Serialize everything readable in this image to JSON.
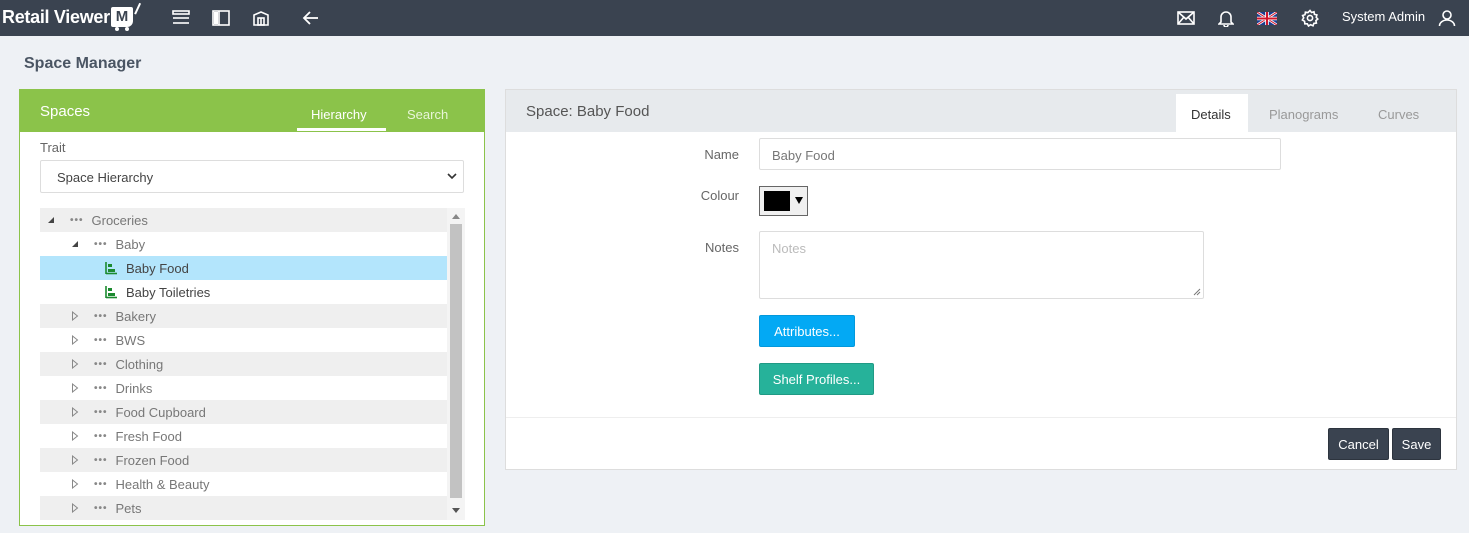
{
  "app": {
    "brand": "Retail Viewer",
    "brand_mark": "M",
    "user_name": "System Admin"
  },
  "page": {
    "title": "Space Manager"
  },
  "spaces_panel": {
    "title": "Spaces",
    "tabs": [
      {
        "label": "Hierarchy",
        "active": true
      },
      {
        "label": "Search",
        "active": false
      }
    ],
    "trait_label": "Trait",
    "trait_value": "Space Hierarchy",
    "tree": [
      {
        "label": "Groceries",
        "level": 0,
        "state": "expanded",
        "type": "group"
      },
      {
        "label": "Baby",
        "level": 1,
        "state": "expanded",
        "type": "group"
      },
      {
        "label": "Baby Food",
        "level": 2,
        "state": "leaf",
        "type": "space",
        "selected": true
      },
      {
        "label": "Baby Toiletries",
        "level": 2,
        "state": "leaf",
        "type": "space"
      },
      {
        "label": "Bakery",
        "level": 1,
        "state": "collapsed",
        "type": "group"
      },
      {
        "label": "BWS",
        "level": 1,
        "state": "collapsed",
        "type": "group"
      },
      {
        "label": "Clothing",
        "level": 1,
        "state": "collapsed",
        "type": "group"
      },
      {
        "label": "Drinks",
        "level": 1,
        "state": "collapsed",
        "type": "group"
      },
      {
        "label": "Food Cupboard",
        "level": 1,
        "state": "collapsed",
        "type": "group"
      },
      {
        "label": "Fresh Food",
        "level": 1,
        "state": "collapsed",
        "type": "group"
      },
      {
        "label": "Frozen Food",
        "level": 1,
        "state": "collapsed",
        "type": "group"
      },
      {
        "label": "Health & Beauty",
        "level": 1,
        "state": "collapsed",
        "type": "group"
      },
      {
        "label": "Pets",
        "level": 1,
        "state": "collapsed",
        "type": "group"
      }
    ]
  },
  "detail_panel": {
    "title": "Space: Baby Food",
    "tabs": [
      {
        "label": "Details",
        "active": true
      },
      {
        "label": "Planograms",
        "active": false
      },
      {
        "label": "Curves",
        "active": false
      }
    ],
    "name_label": "Name",
    "name_value": "Baby Food",
    "colour_label": "Colour",
    "colour_value": "#000000",
    "notes_label": "Notes",
    "notes_placeholder": "Notes",
    "attributes_button": "Attributes...",
    "shelf_profiles_button": "Shelf Profiles...",
    "cancel_button": "Cancel",
    "save_button": "Save"
  },
  "colors": {
    "topbar": "#3a4350",
    "accent_green": "#8bc34a",
    "primary_blue": "#03a9f4",
    "teal": "#26b29a",
    "selection": "#b3e5fc"
  }
}
